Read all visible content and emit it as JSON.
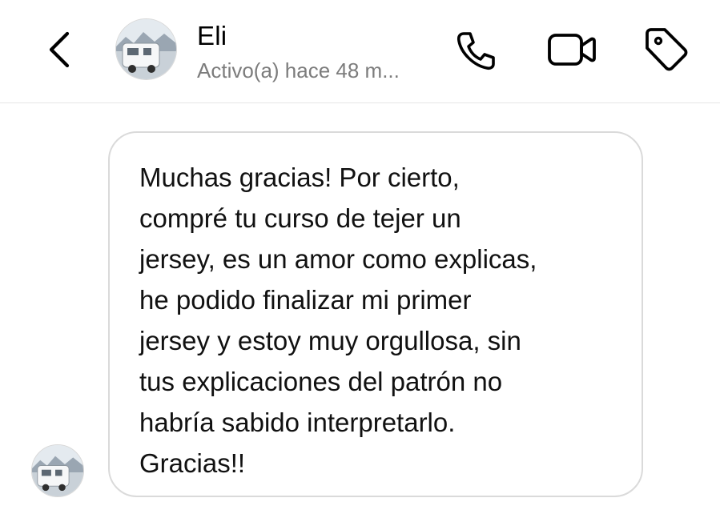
{
  "header": {
    "back_icon": "chevron-left-icon",
    "contact_name": "Eli",
    "status": "Activo(a) hace 48 m...",
    "icons": [
      "phone-icon",
      "video-camera-icon",
      "tag-icon"
    ]
  },
  "conversation": {
    "messages": [
      {
        "sender": "Eli",
        "text": "Muchas gracias! Por cierto,\ncompré tu curso de tejer un\njersey, es un amor como explicas,\nhe podido finalizar mi primer\njersey y estoy muy orgullosa, sin\ntus explicaciones del patrón no\nhabría sabido interpretarlo.\nGracias!!"
      }
    ]
  },
  "colors": {
    "status_text": "#7c7c7c",
    "bubble_border": "#dadada",
    "divider": "#e6e6e6"
  }
}
